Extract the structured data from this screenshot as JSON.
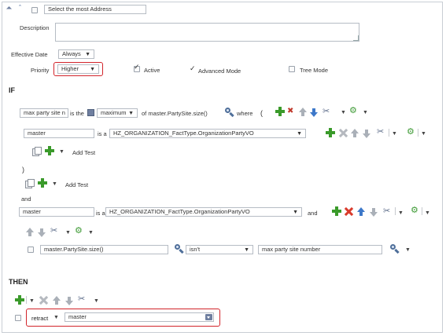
{
  "rule": {
    "name_value": "Select the most Address",
    "description_label": "Description",
    "description_value": "",
    "effective_date_label": "Effective Date",
    "effective_date_value": "Always",
    "priority_label": "Priority",
    "priority_value": "Higher",
    "active_label": "Active",
    "advanced_mode_label": "Advanced Mode",
    "tree_mode_label": "Tree Mode"
  },
  "if_section": {
    "heading": "IF",
    "row1": {
      "left_value": "max party site n",
      "is_the_label": "is the",
      "function_value": "maximum",
      "of_label": "of master.PartySite.size()",
      "where_label": "where",
      "open_paren": "("
    },
    "row2": {
      "var_value": "master",
      "is_a_label": "is a",
      "type_value": "HZ_ORGANIZATION_FactType.OrganizationPartyVO"
    },
    "add_test_1": "Add Test",
    "close_paren": ")",
    "add_test_2": "Add Test",
    "and_1": "and",
    "row3": {
      "var_value": "master",
      "is_a_label": "is a",
      "type_value": "HZ_ORGANIZATION_FactType.OrganizationPartyVO",
      "and_label": "and"
    },
    "row4": {
      "left_value": "master.PartySite.size()",
      "operator_value": "isn't",
      "right_value": "max party site number"
    }
  },
  "then_section": {
    "heading": "THEN",
    "action_value": "retract",
    "target_value": "master"
  },
  "colors": {
    "highlight": "#d2232a",
    "add_green": "#3a9a2a",
    "delete_red": "#d93a2b",
    "border": "#b6bcc4"
  }
}
